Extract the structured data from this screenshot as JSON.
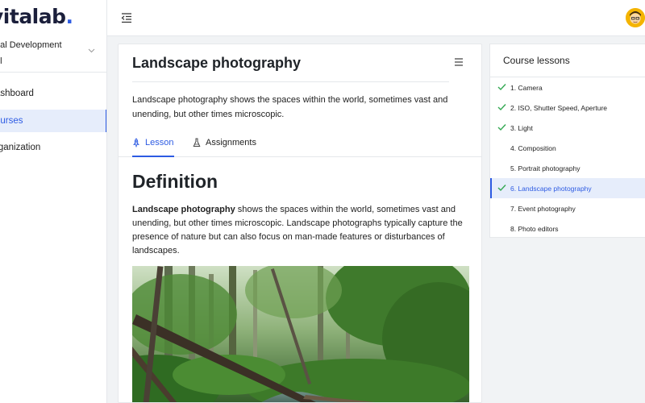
{
  "brand": {
    "logo_text": "vitalab",
    "logo_dot": "."
  },
  "org_select": {
    "label": "nal Development",
    "value": "ol"
  },
  "sidebar": {
    "items": [
      {
        "label": "ashboard"
      },
      {
        "label": "ourses"
      },
      {
        "label": "rganization"
      }
    ]
  },
  "page": {
    "title": "Landscape photography",
    "description": "Landscape photography shows the spaces within the world, sometimes vast and unending, but other times microscopic."
  },
  "tabs": [
    {
      "label": "Lesson",
      "icon": "rocket-icon"
    },
    {
      "label": "Assignments",
      "icon": "flask-icon"
    }
  ],
  "lesson_content": {
    "heading": "Definition",
    "bold_term": "Landscape photography",
    "paragraph": " shows the spaces within the world, sometimes vast and unending, but other times microscopic. Landscape photographs typically capture the presence of nature but can also focus on man-made features or disturbances of landscapes."
  },
  "course_lessons": {
    "title": "Course lessons",
    "items": [
      {
        "label": "1. Camera",
        "completed": true
      },
      {
        "label": "2. ISO, Shutter Speed, Aperture",
        "completed": true
      },
      {
        "label": "3. Light",
        "completed": true
      },
      {
        "label": "4. Composition",
        "completed": false
      },
      {
        "label": "5. Portrait photography",
        "completed": false
      },
      {
        "label": "6. Landscape photography",
        "completed": true
      },
      {
        "label": "7. Event photography",
        "completed": false
      },
      {
        "label": "8. Photo editors",
        "completed": false
      }
    ]
  },
  "colors": {
    "accent": "#2d5be3",
    "active_bg": "#e6edfb",
    "check": "#34a853",
    "brand_dark": "#1b1f3b"
  }
}
